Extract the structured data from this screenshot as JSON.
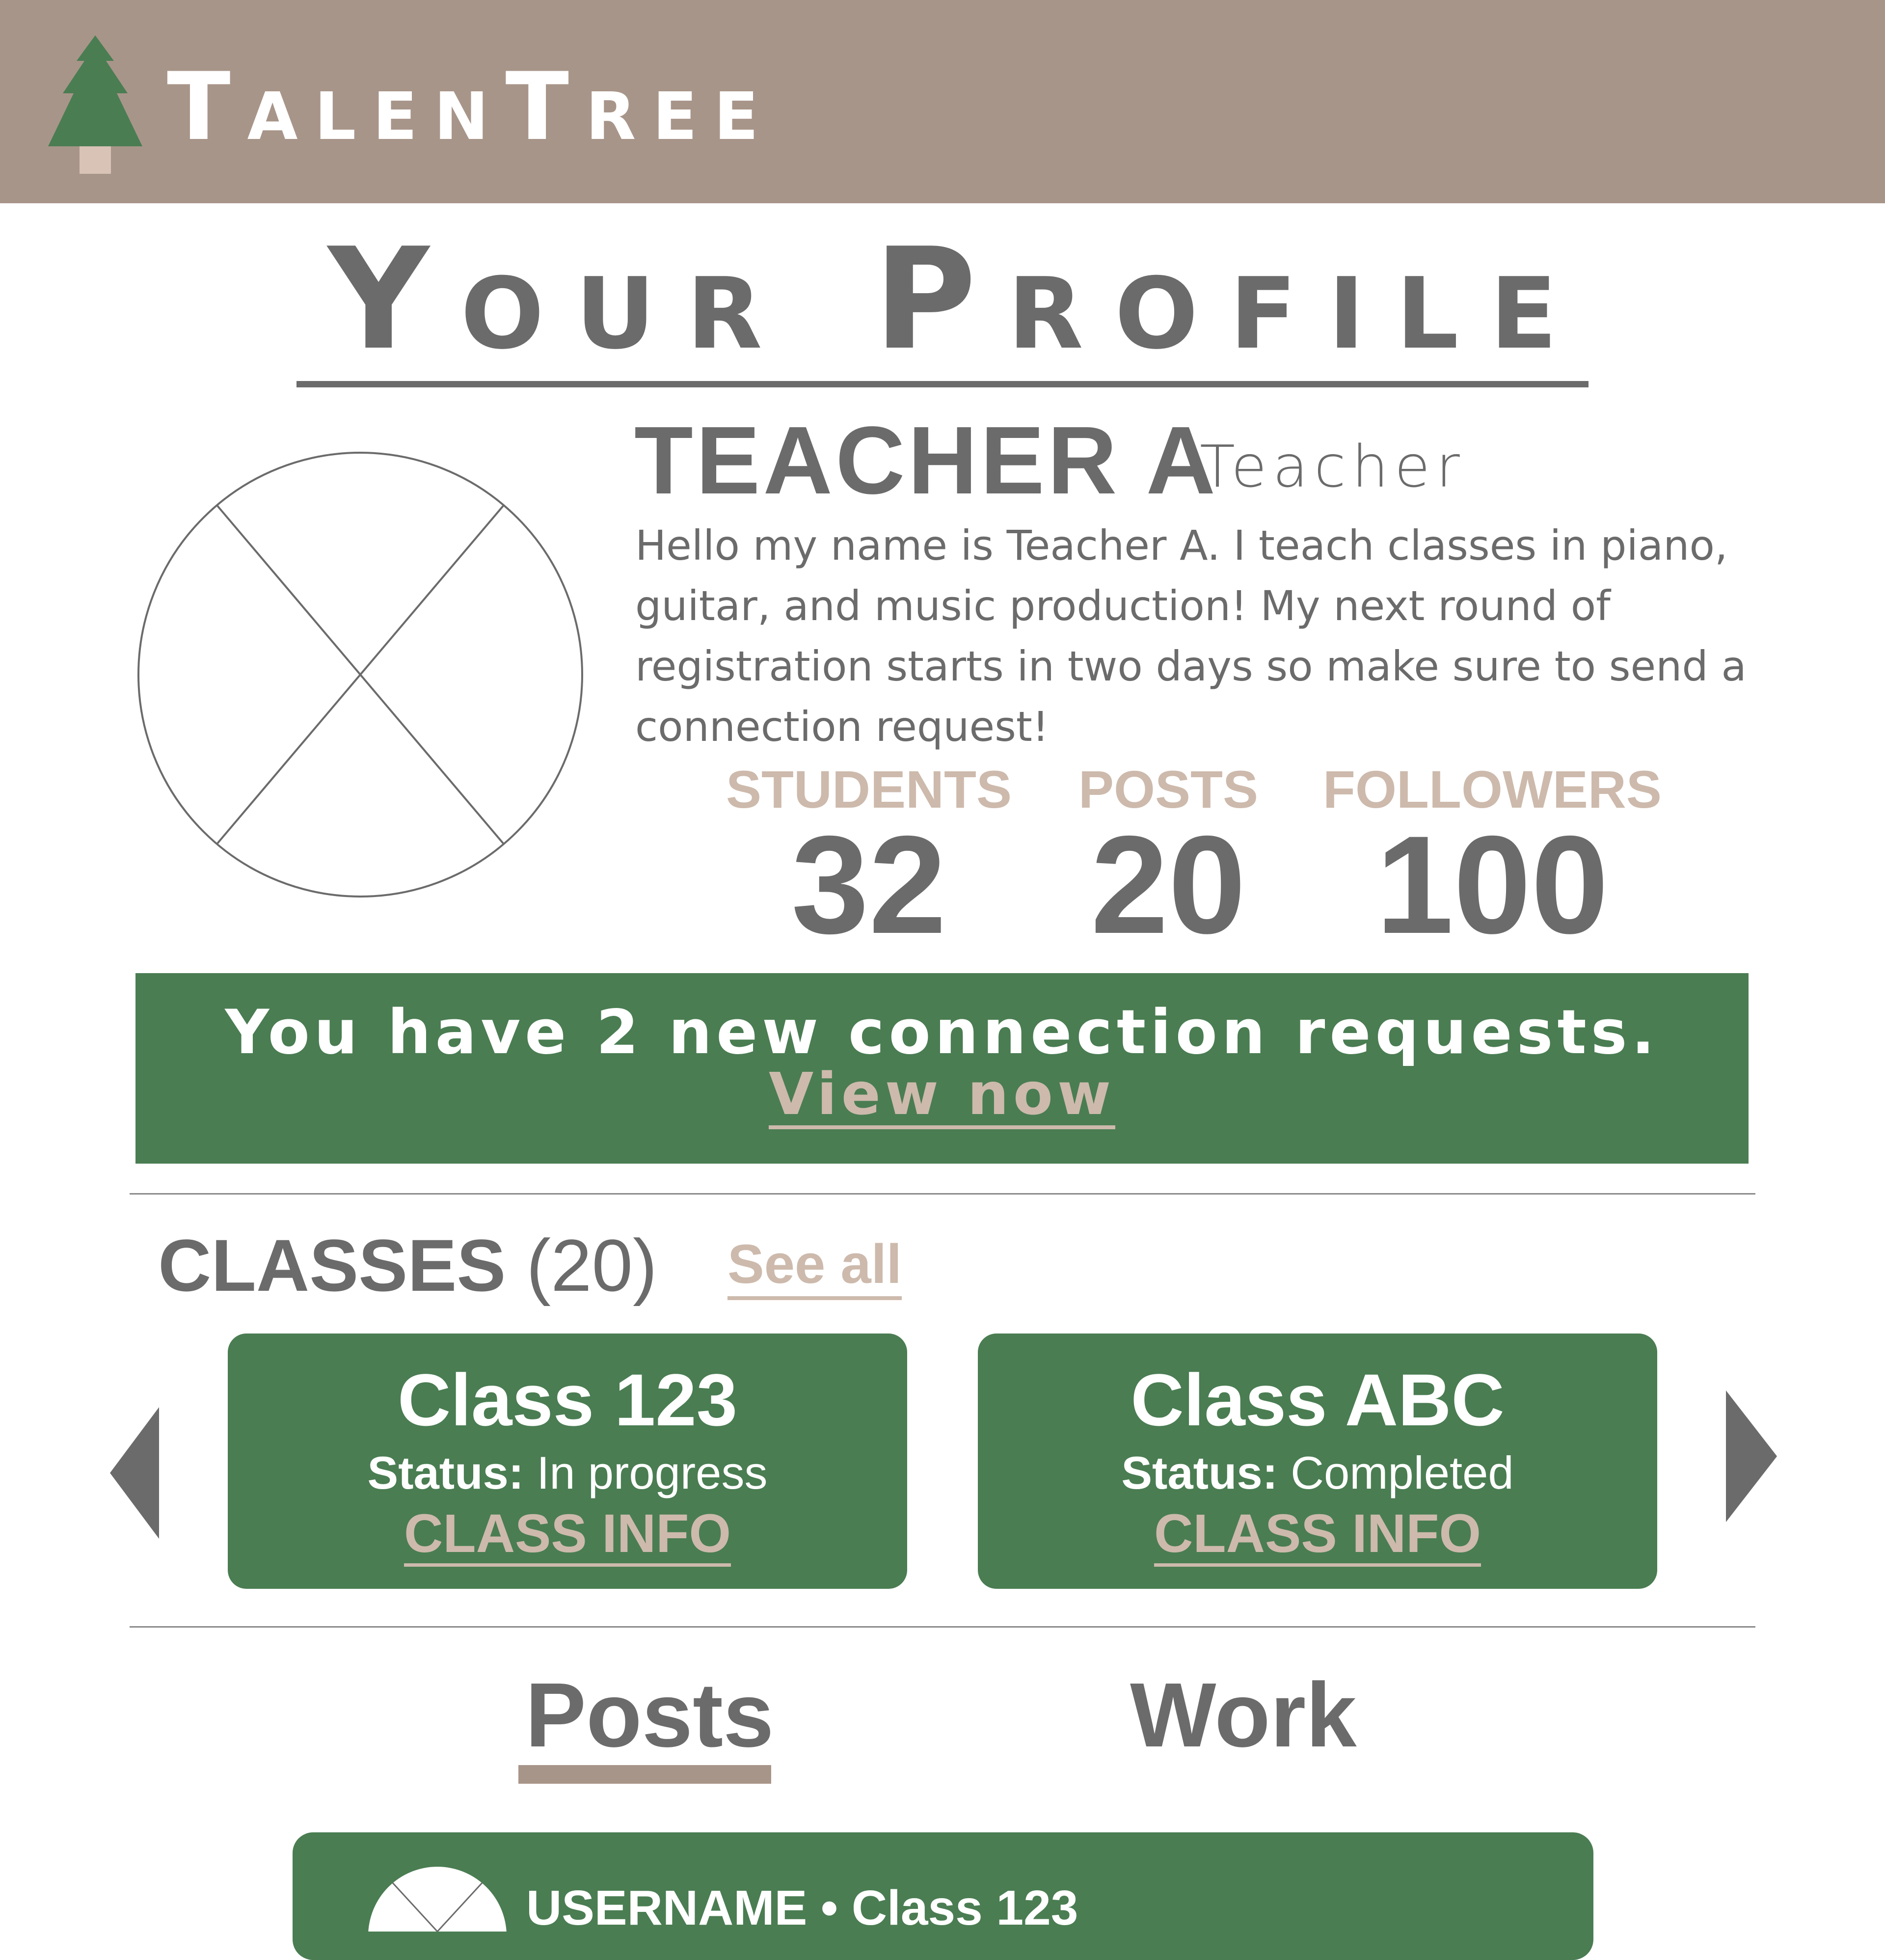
{
  "header": {
    "brand": "TalenTree"
  },
  "page": {
    "title": "Your Profile"
  },
  "profile": {
    "name": "TEACHER A",
    "role": "Teacher",
    "bio": "Hello my name is Teacher A. I teach classes in piano, guitar, and music production! My next round of registration starts in two days so make sure to send a connection request!",
    "stats": [
      {
        "label": "STUDENTS",
        "value": "32"
      },
      {
        "label": "POSTS",
        "value": "20"
      },
      {
        "label": "FOLLOWERS",
        "value": "100"
      }
    ]
  },
  "banner": {
    "text": "You have 2 new connection requests.",
    "link": "View now"
  },
  "classes": {
    "title": "CLASSES",
    "count": "(20)",
    "see_all": "See all",
    "cards": [
      {
        "name": "Class 123",
        "status_label": "Status:",
        "status": "In progress",
        "info": "CLASS INFO"
      },
      {
        "name": "Class ABC",
        "status_label": "Status:",
        "status": "Completed",
        "info": "CLASS INFO"
      }
    ]
  },
  "tabs": [
    {
      "label": "Posts",
      "active": true
    },
    {
      "label": "Work",
      "active": false
    }
  ],
  "post": {
    "meta": "USERNAME • Class 123"
  },
  "colors": {
    "header": "#a89589",
    "green": "#4a7d52",
    "tan": "#cdbaac",
    "gray": "#6b6b6b"
  }
}
